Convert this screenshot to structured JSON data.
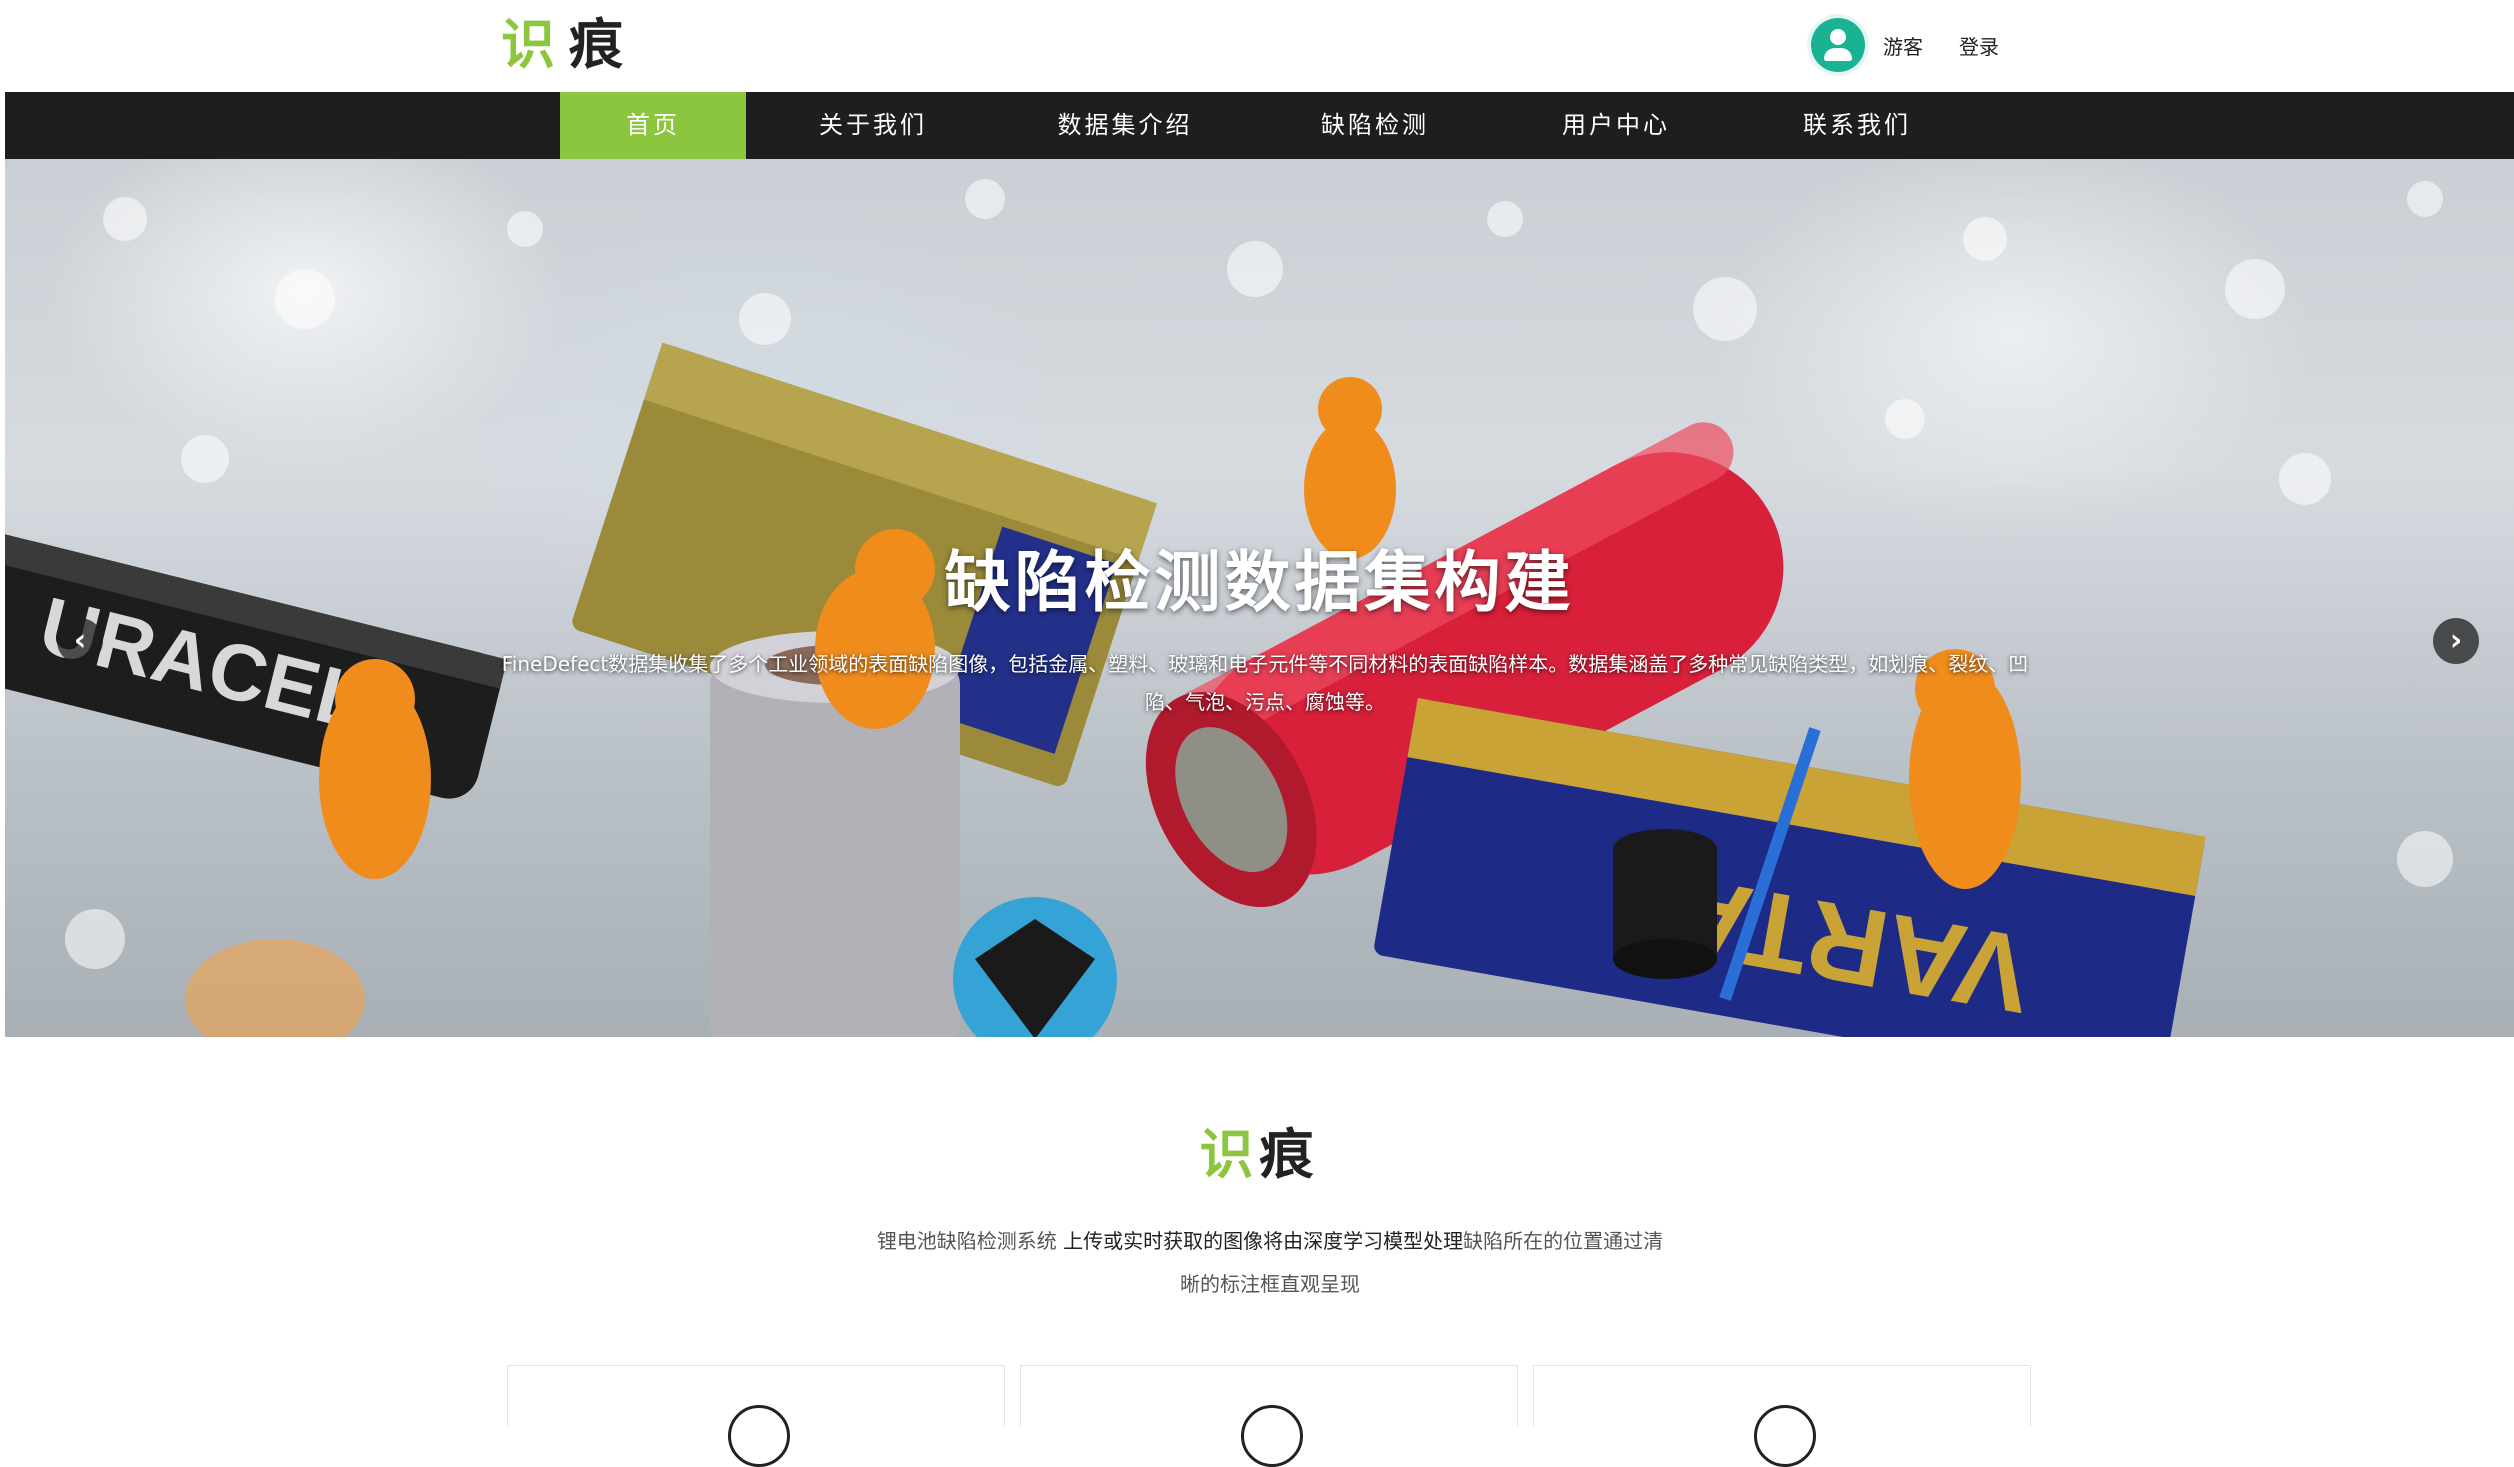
{
  "header": {
    "logo_char1": "识",
    "logo_char2": "痕",
    "user_label": "游客",
    "login_label": "登录"
  },
  "nav": {
    "items": [
      {
        "label": "首页",
        "active": true
      },
      {
        "label": "关于我们",
        "active": false
      },
      {
        "label": "数据集介绍",
        "active": false
      },
      {
        "label": "缺陷检测",
        "active": false
      },
      {
        "label": "用户中心",
        "active": false
      },
      {
        "label": "联系我们",
        "active": false
      }
    ]
  },
  "banner": {
    "title": "缺陷检测数据集构建",
    "description": "FineDefect数据集收集了多个工业领域的表面缺陷图像，包括金属、塑料、玻璃和电子元件等不同材料的表面缺陷样本。数据集涵盖了多种常见缺陷类型，如划痕、裂纹、凹陷、气泡、污点、腐蚀等。",
    "prev_arrow": "‹",
    "next_arrow": "›"
  },
  "intro": {
    "logo_char1": "识",
    "logo_char2": "痕",
    "text_part1": "锂电池缺陷检测系统 ",
    "text_part2": "上传或实时获取的图像将由深度学习模型处理",
    "text_part3": "缺陷所在的位置通过清晰的标注框直观呈现"
  },
  "colors": {
    "accent": "#8cc63f",
    "nav_bg": "#1e1e1e",
    "avatar": "#19b394"
  },
  "icons": {
    "avatar": "user-avatar-icon",
    "prev": "chevron-left-icon",
    "next": "chevron-right-icon"
  }
}
